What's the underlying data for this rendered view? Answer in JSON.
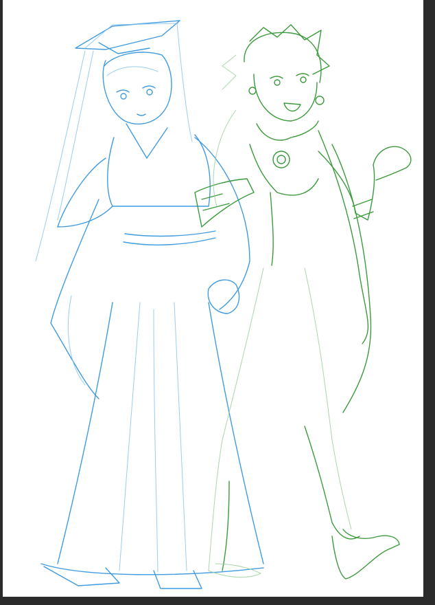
{
  "app": {
    "background": "#2b2b2b"
  },
  "canvas": {
    "background": "#ffffff",
    "content": "two-character-sketch"
  },
  "colors": {
    "blue_sketch": "#3f9be0",
    "green_sketch": "#3b9a3b"
  }
}
